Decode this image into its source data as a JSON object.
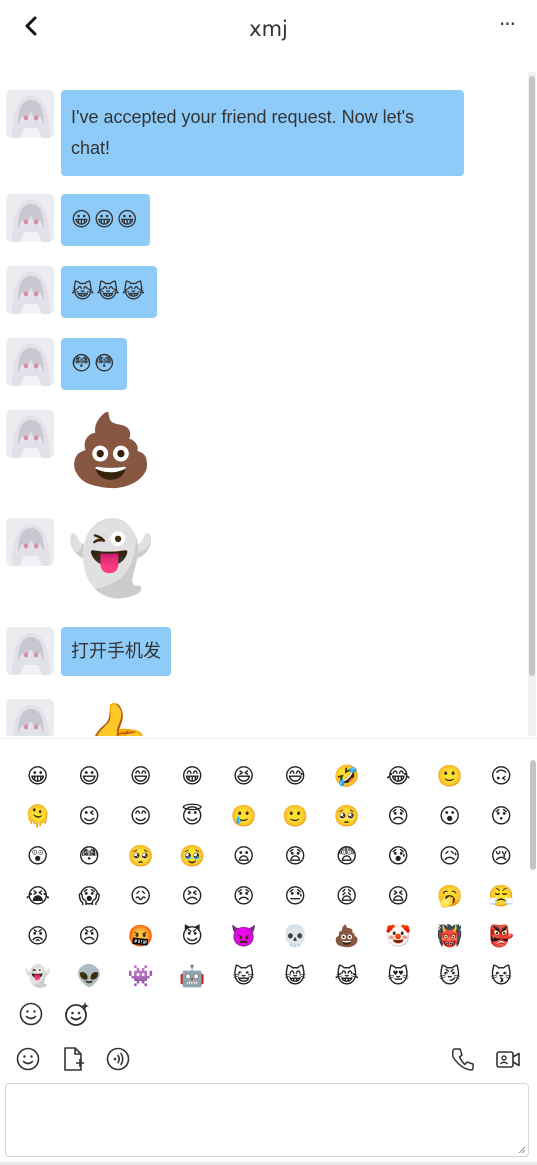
{
  "header": {
    "title": "xmj",
    "more_label": "···"
  },
  "messages": [
    {
      "type": "text",
      "text": "I've accepted your friend request. Now let's chat!"
    },
    {
      "type": "emoji",
      "text": "😀😀😀"
    },
    {
      "type": "emoji",
      "text": "😹😹😹"
    },
    {
      "type": "emoji",
      "text": "😳😳"
    },
    {
      "type": "sticker",
      "text": "💩"
    },
    {
      "type": "sticker",
      "text": "👻"
    },
    {
      "type": "text",
      "text": "打开手机发"
    },
    {
      "type": "sticker",
      "text": "👍"
    }
  ],
  "emoji_panel": {
    "emojis": [
      "😀",
      "😃",
      "😄",
      "😁",
      "😆",
      "😅",
      "🤣",
      "😂",
      "🙂",
      "🙃",
      "🫠",
      "😉",
      "😊",
      "😇",
      "🥲",
      "🙂",
      "🥺",
      "😞",
      "😮",
      "😯",
      "😲",
      "😳",
      "🥺",
      "🥹",
      "😦",
      "😧",
      "😨",
      "😰",
      "😥",
      "😢",
      "😭",
      "😱",
      "😖",
      "😣",
      "😞",
      "😓",
      "😩",
      "😫",
      "🥱",
      "😤",
      "😡",
      "😠",
      "🤬",
      "😈",
      "👿",
      "💀",
      "💩",
      "🤡",
      "👹",
      "👺",
      "👻",
      "👽",
      "👾",
      "🤖",
      "😺",
      "😸",
      "😹",
      "😻",
      "😼",
      "😽"
    ],
    "tabs": [
      "smile-tab",
      "sticker-tab"
    ]
  },
  "toolbar": {
    "tools_left": [
      "emoji",
      "file",
      "voice"
    ],
    "tools_right": [
      "phone",
      "video"
    ]
  },
  "input": {
    "value": ""
  },
  "colors": {
    "bubble": "#8ecbf9",
    "accent": "#333333"
  }
}
